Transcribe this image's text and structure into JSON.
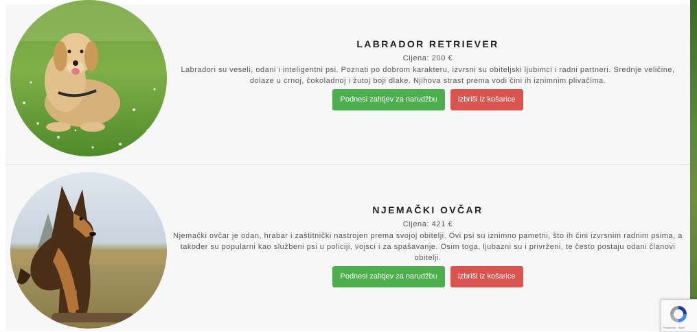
{
  "products": [
    {
      "title": "LABRADOR RETRIEVER",
      "price": "Cijena: 200 €",
      "description": "Labradori su veseli, odani i inteligentni psi. Poznati po dobrom karakteru, izvrsni su obiteljski ljubimci i radni partneri. Srednje veličine, dolaze u crnoj, čokoladnoj i žutoj boji dlake. Njihova strast prema vodi čini ih iznimnim plivačima.",
      "order_label": "Podnesi zahtjev za narudžbu",
      "remove_label": "Izbriši iz košarice"
    },
    {
      "title": "NJEMAČKI OVČAR",
      "price": "Cijena: 421 €",
      "description": "Njemački ovčar je odan, hrabar i zaštitnički nastrojen prema svojoj obitelji. Ovi psi su iznimno pametni, što ih čini izvrsnim radnim psima, a također su popularni kao službeni psi u policiji, vojsci i za spašavanje. Osim toga, ljubazni su i privrženi, te često postaju odani članovi obitelji.",
      "order_label": "Podnesi zahtjev za narudžbu",
      "remove_label": "Izbriši iz košarice"
    }
  ],
  "recaptcha": {
    "icon": "recaptcha-icon",
    "note": "Privatnost - Uvjeti"
  },
  "colors": {
    "order_button": "#4cae4c",
    "remove_button": "#d9534f",
    "card_background": "#f7f7f7"
  }
}
